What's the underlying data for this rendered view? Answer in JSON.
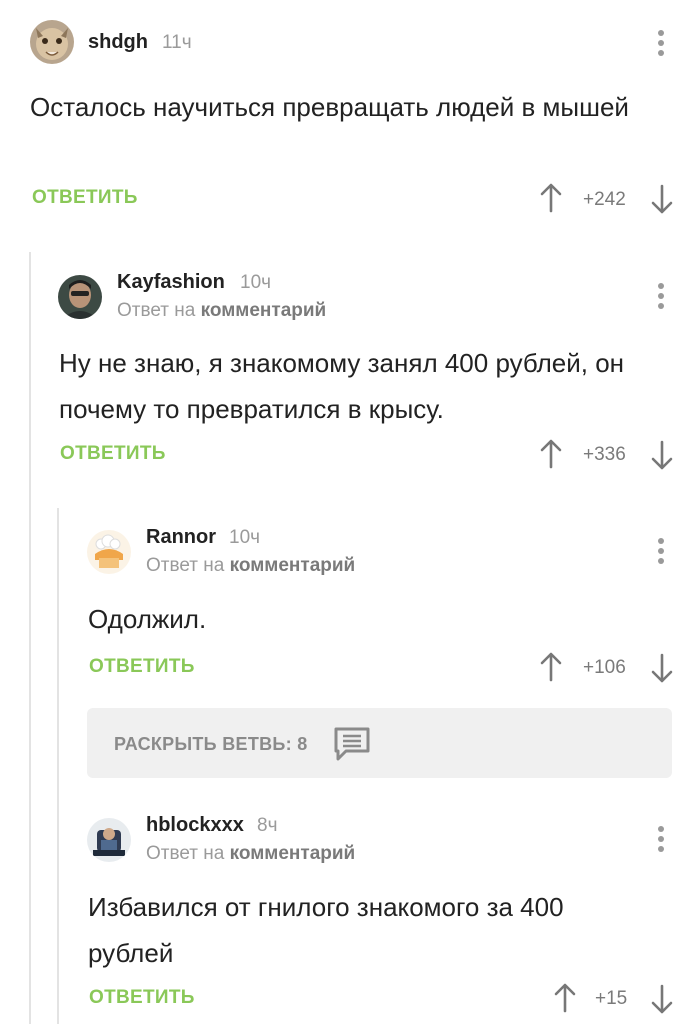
{
  "comments": [
    {
      "author": "shdgh",
      "time": "11ч",
      "text": "Осталось научиться превращать людей в мышей",
      "reply_label": "ОТВЕТИТЬ",
      "score": "+242"
    },
    {
      "author": "Kayfashion",
      "time": "10ч",
      "reply_prefix": "Ответ на",
      "reply_target": "комментарий",
      "text": "Ну не знаю, я знакомому занял 400 рублей, он почему то превратился в крысу.",
      "reply_label": "ОТВЕТИТЬ",
      "score": "+336"
    },
    {
      "author": "Rannor",
      "time": "10ч",
      "reply_prefix": "Ответ на",
      "reply_target": "комментарий",
      "text": "Одолжил.",
      "reply_label": "ОТВЕТИТЬ",
      "score": "+106"
    },
    {
      "author": "hblockxxx",
      "time": "8ч",
      "reply_prefix": "Ответ на",
      "reply_target": "комментарий",
      "text": "Избавился от гнилого знакомого за 400 рублей",
      "reply_label": "ОТВЕТИТЬ",
      "score": "+15"
    }
  ],
  "expand_thread": {
    "label": "РАСКРЫТЬ ВЕТВЬ: 8",
    "icon": "comment-icon"
  },
  "colors": {
    "reply": "#8ac858",
    "muted": "#9a9a9a",
    "text": "#222222",
    "thread_line": "#e3e3e3",
    "expand_bg": "#f0f0f0"
  }
}
